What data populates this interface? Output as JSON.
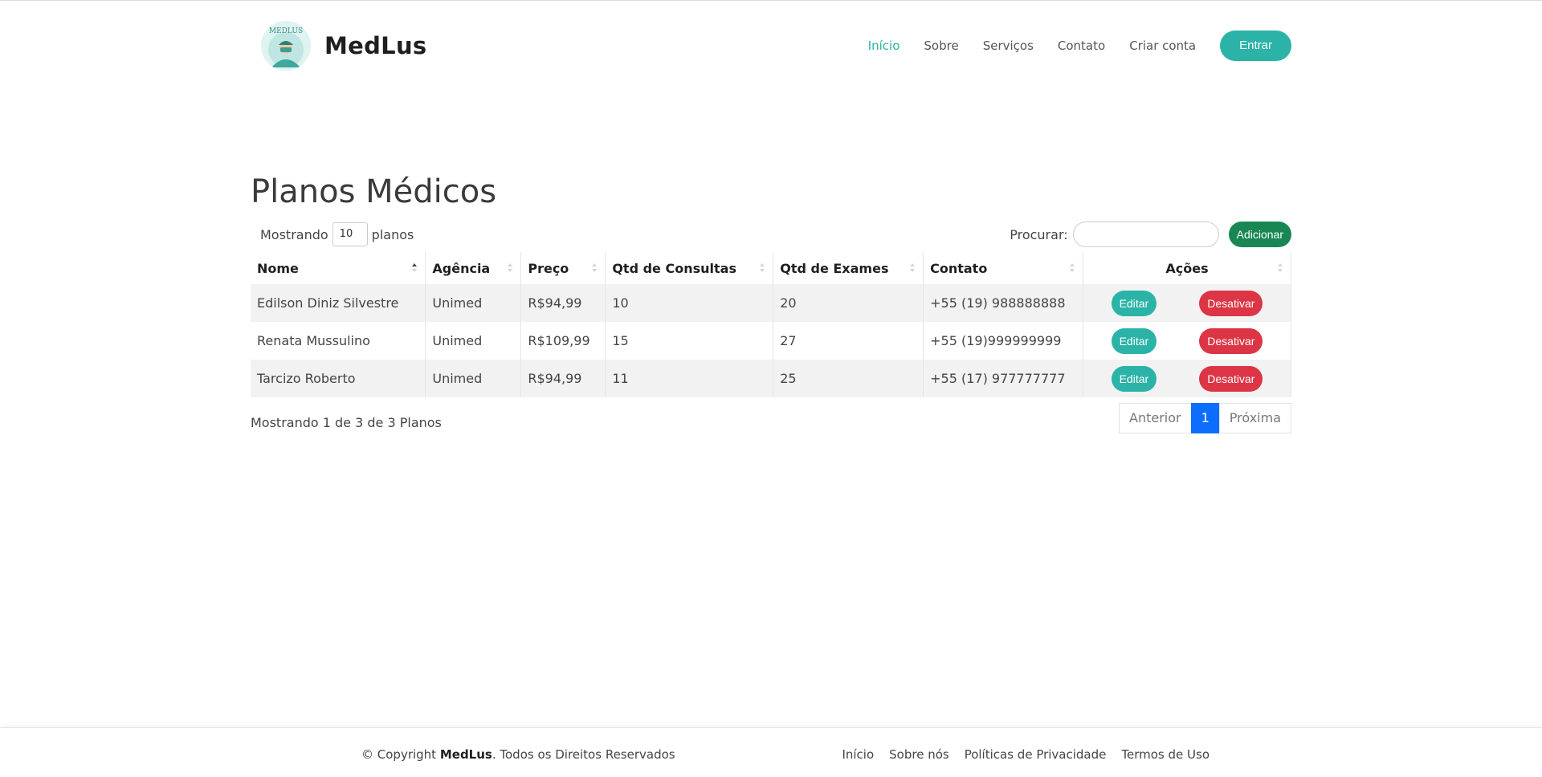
{
  "header": {
    "brand": "MedLus",
    "logo_text": "MEDLUS",
    "nav": [
      "Início",
      "Sobre",
      "Serviços",
      "Contato",
      "Criar conta"
    ],
    "login_label": "Entrar"
  },
  "page_title": "Planos Médicos",
  "length_control": {
    "prefix": "Mostrando",
    "value": "10",
    "suffix": "planos"
  },
  "search": {
    "label": "Procurar:",
    "value": ""
  },
  "add_label": "Adicionar",
  "table": {
    "columns": [
      "Nome",
      "Agência",
      "Preço",
      "Qtd de Consultas",
      "Qtd de Exames",
      "Contato",
      "Ações"
    ],
    "rows": [
      [
        "Edilson Diniz Silvestre",
        "Unimed",
        "R$94,99",
        "10",
        "20",
        "+55 (19) 988888888"
      ],
      [
        "Renata Mussulino",
        "Unimed",
        "R$109,99",
        "15",
        "27",
        "+55 (19)999999999"
      ],
      [
        "Tarcizo Roberto",
        "Unimed",
        "R$94,99",
        "11",
        "25",
        "+55 (17) 977777777"
      ]
    ],
    "edit_label": "Editar",
    "deactivate_label": "Desativar"
  },
  "info_text": "Mostrando 1 de 3 de 3 Planos",
  "pagination": {
    "prev": "Anterior",
    "current": "1",
    "next": "Próxima"
  },
  "footer": {
    "copyright_prefix": "© Copyright",
    "brand": "MedLus",
    "rights": ". Todos os Direitos Reservados",
    "links": [
      "Início",
      "Sobre nós",
      "Políticas de Privacidade",
      "Termos de Uso"
    ]
  },
  "colors": {
    "accent": "#2bb3a7",
    "add_button": "#198754",
    "danger": "#dc3545",
    "page_active": "#0d6efd"
  }
}
